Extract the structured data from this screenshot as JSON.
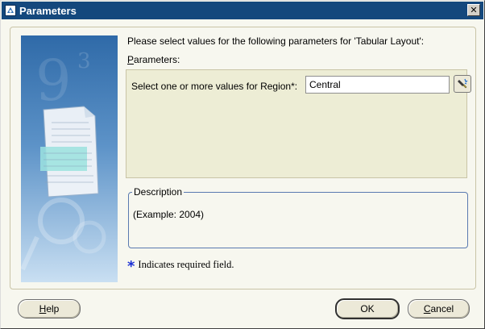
{
  "window": {
    "title": "Parameters",
    "close_glyph": "✕"
  },
  "intro_text": "Please select values for the following parameters for 'Tabular Layout':",
  "parameters": {
    "label_mnemonic": "P",
    "label_rest": "arameters:",
    "region_label": "Select one or more values for Region*:",
    "region_value": "Central"
  },
  "description": {
    "legend": "Description",
    "text": "(Example: 2004)"
  },
  "required_note": {
    "star": "*",
    "text": "Indicates required field."
  },
  "buttons": {
    "help_mnemonic": "H",
    "help_rest": "elp",
    "ok": "OK",
    "cancel_mnemonic": "C",
    "cancel_rest": "ancel"
  },
  "icons": {
    "title": "app-icon",
    "close": "close-icon",
    "lov": "flashlight-search-icon",
    "side_image": "document-illustration"
  },
  "colors": {
    "titlebar": "#14487d",
    "dialog_bg": "#f7f7ef",
    "params_bg": "#ededd5",
    "desc_border": "#5a7ab0",
    "required_star": "#1a2fd4"
  }
}
